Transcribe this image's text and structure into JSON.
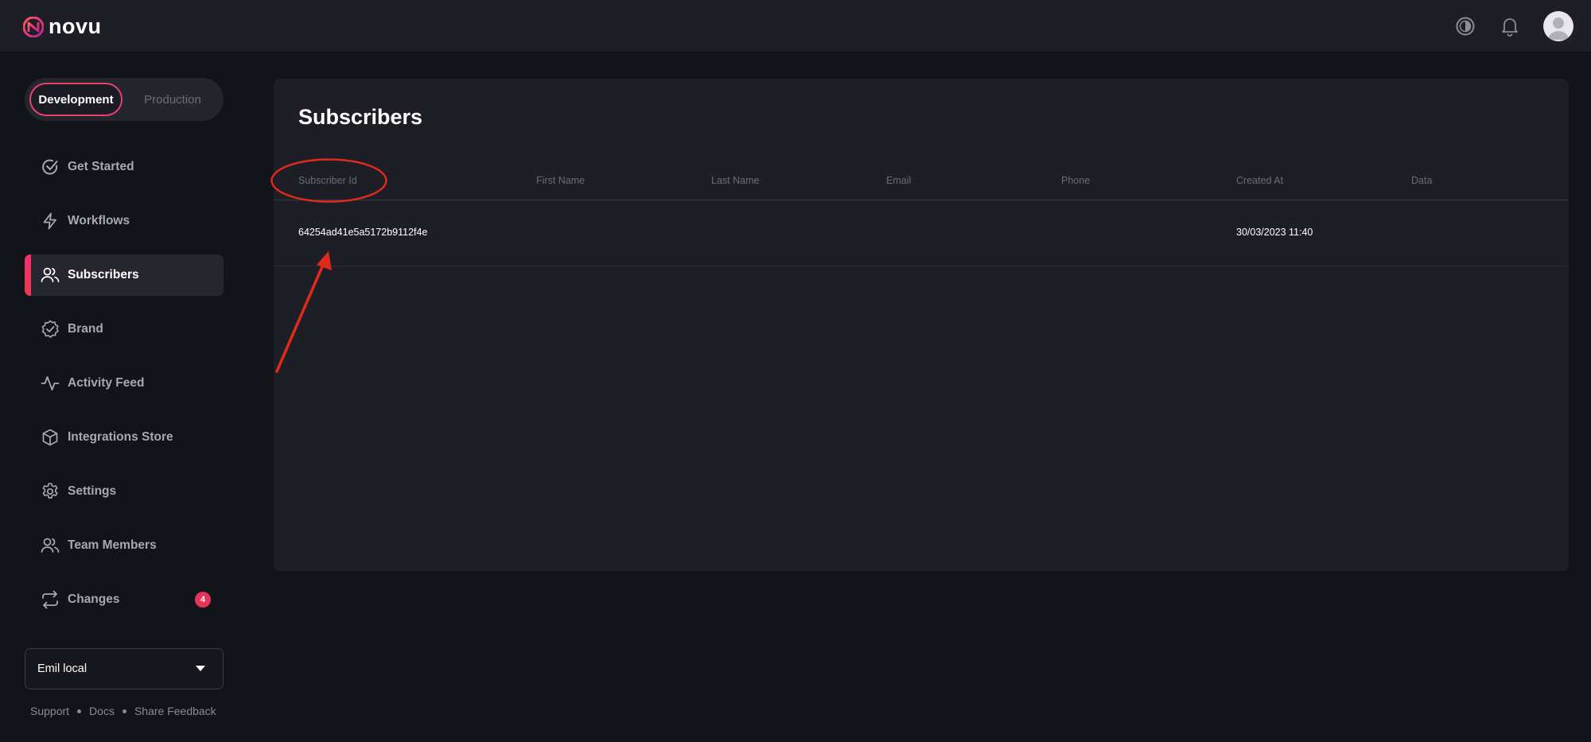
{
  "app": {
    "logo_text": "novu"
  },
  "colors": {
    "accent": "#e6416f",
    "annotation": "#e02a1a",
    "badge": "#e5335a"
  },
  "header": {
    "icons": [
      "theme-toggle-icon",
      "bell-icon",
      "user-avatar"
    ]
  },
  "sidebar": {
    "environment": {
      "options": [
        "Development",
        "Production"
      ],
      "selected": "Development"
    },
    "items": [
      {
        "label": "Get Started",
        "icon": "check-circle-icon"
      },
      {
        "label": "Workflows",
        "icon": "lightning-icon"
      },
      {
        "label": "Subscribers",
        "icon": "users-icon",
        "active": true
      },
      {
        "label": "Brand",
        "icon": "badge-check-icon"
      },
      {
        "label": "Activity Feed",
        "icon": "activity-icon"
      },
      {
        "label": "Integrations Store",
        "icon": "box-icon"
      },
      {
        "label": "Settings",
        "icon": "gear-icon"
      },
      {
        "label": "Team Members",
        "icon": "team-icon"
      },
      {
        "label": "Changes",
        "icon": "arrows-swap-icon",
        "badge": "4"
      }
    ],
    "organization": "Emil local",
    "footer_links": [
      "Support",
      "Docs",
      "Share Feedback"
    ]
  },
  "main": {
    "title": "Subscribers",
    "columns": [
      "Subscriber Id",
      "First Name",
      "Last Name",
      "Email",
      "Phone",
      "Created At",
      "Data"
    ],
    "rows": [
      {
        "subscriber_id": "64254ad41e5a5172b9112f4e",
        "first_name": "",
        "last_name": "",
        "email": "",
        "phone": "",
        "created_at": "30/03/2023 11:40",
        "data": ""
      }
    ]
  }
}
